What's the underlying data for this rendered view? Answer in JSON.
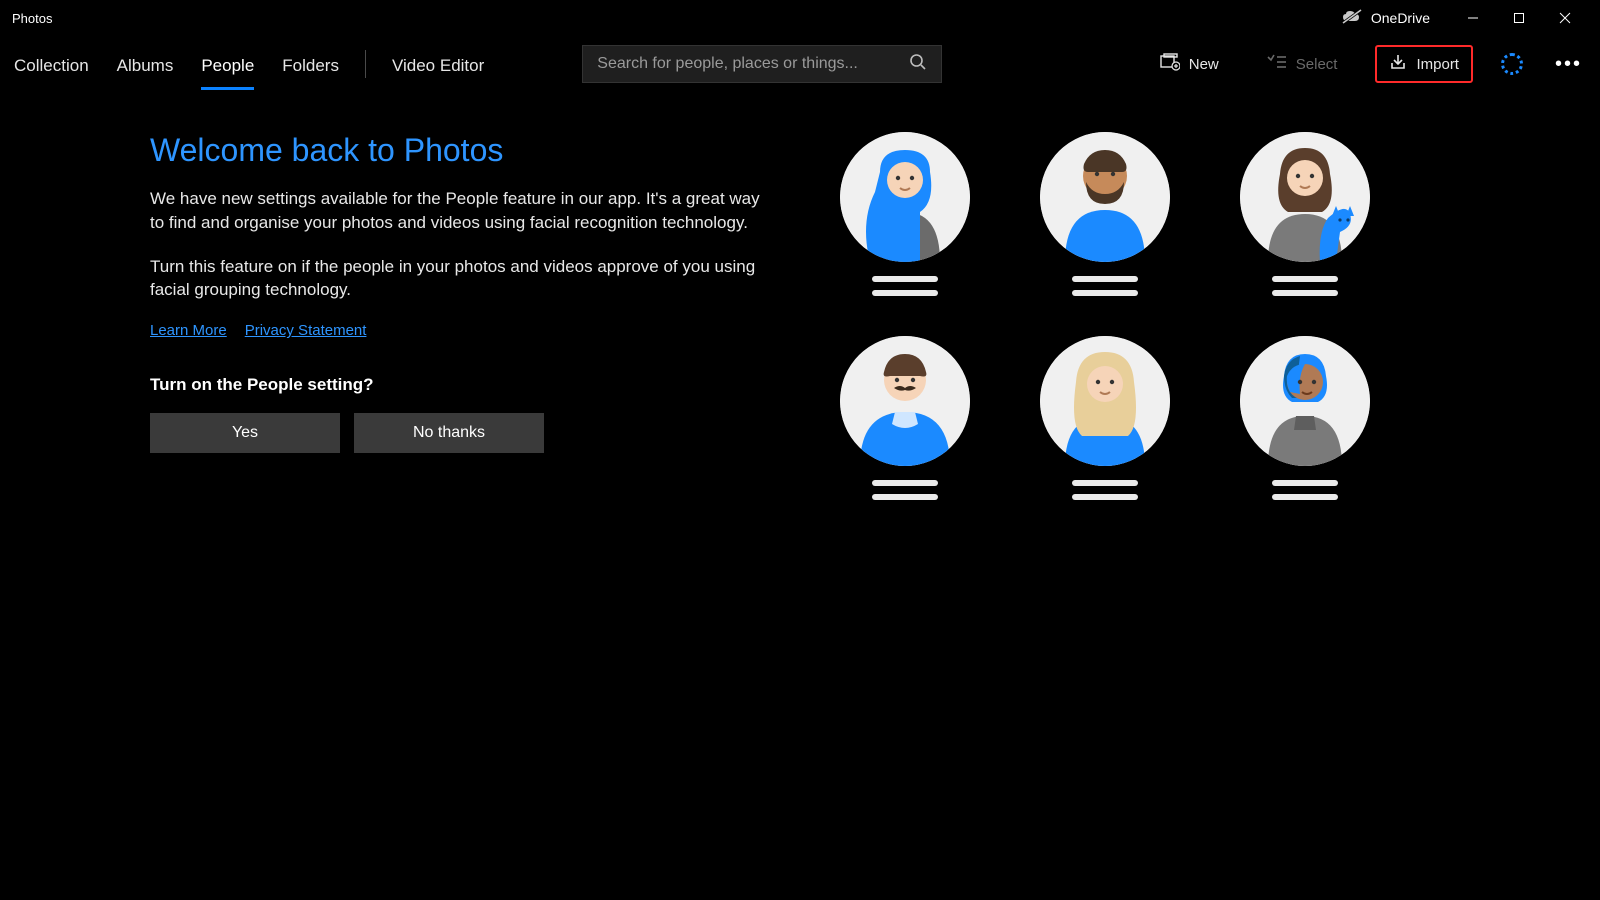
{
  "app": {
    "title": "Photos"
  },
  "titlebar": {
    "onedrive": "OneDrive"
  },
  "tabs": [
    "Collection",
    "Albums",
    "People",
    "Folders",
    "Video Editor"
  ],
  "activeTab": 2,
  "search": {
    "placeholder": "Search for people, places or things..."
  },
  "toolbar": {
    "new": "New",
    "select": "Select",
    "import": "Import"
  },
  "welcome": {
    "heading": "Welcome back to Photos",
    "p1": "We have new settings available for the People feature in our app. It's a great way to find and organise your photos and videos using facial recognition technology.",
    "p2": "Turn this feature on if the people in your photos and videos approve of you using facial grouping technology.",
    "learnMore": "Learn More",
    "privacy": "Privacy Statement",
    "prompt": "Turn on the People setting?",
    "yes": "Yes",
    "no": "No thanks"
  },
  "avatars": [
    {
      "name": "person-hijab"
    },
    {
      "name": "person-beard"
    },
    {
      "name": "person-with-cat"
    },
    {
      "name": "person-moustache"
    },
    {
      "name": "person-blonde"
    },
    {
      "name": "person-shorthair"
    }
  ]
}
